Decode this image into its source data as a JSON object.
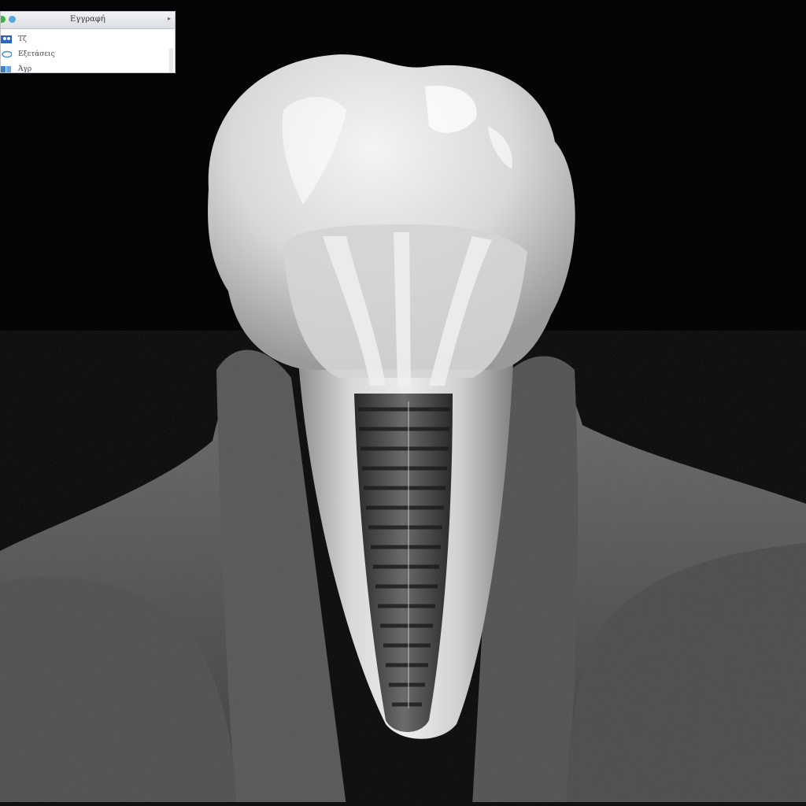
{
  "mini_panel": {
    "title": "Εγγραφή",
    "items": [
      {
        "label": "Τζ",
        "icon": "people-icon"
      },
      {
        "label": "Εξετάσεις",
        "icon": "scan-icon"
      },
      {
        "label": "Άγρ",
        "icon": "layers-icon"
      }
    ]
  },
  "colors": {
    "background": "#050505",
    "bone": "#5a5a5a",
    "tooth_highlight": "#f2f2f2",
    "panel_bg": "#ffffff"
  }
}
